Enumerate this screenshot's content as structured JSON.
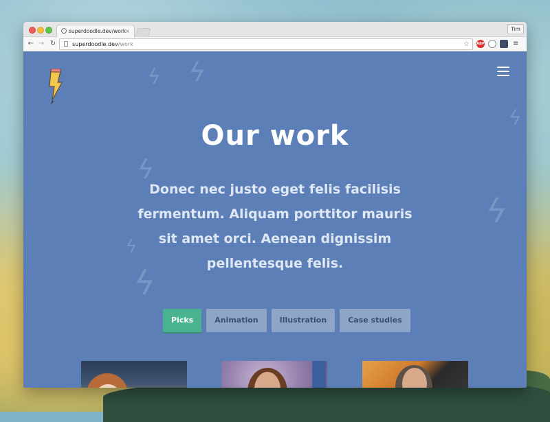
{
  "browser": {
    "tab_title": "superdoodle.dev/work",
    "tab_close": "×",
    "profile_name": "Tim",
    "url_host": "superdoodle.dev",
    "url_path": "/work",
    "back": "←",
    "forward": "→",
    "reload": "↻",
    "star": "☆",
    "menu": "≡",
    "ext_abp": "ABP"
  },
  "page": {
    "title": "Our work",
    "lead": "Donec nec justo eget felis facilisis fermentum. Aliquam porttitor mauris sit amet orci. Aenean dignissim pellentesque felis.",
    "filters": [
      {
        "label": "Picks",
        "active": true
      },
      {
        "label": "Animation",
        "active": false
      },
      {
        "label": "Illustration",
        "active": false
      },
      {
        "label": "Case studies",
        "active": false
      }
    ]
  },
  "colors": {
    "page_bg": "#5b7fb6",
    "accent": "#49b28f",
    "filter_bg": "#8ea5c8"
  },
  "icons": [
    "pencil-logo-icon",
    "hamburger-menu-icon",
    "star-icon",
    "back-icon",
    "forward-icon",
    "reload-icon"
  ]
}
